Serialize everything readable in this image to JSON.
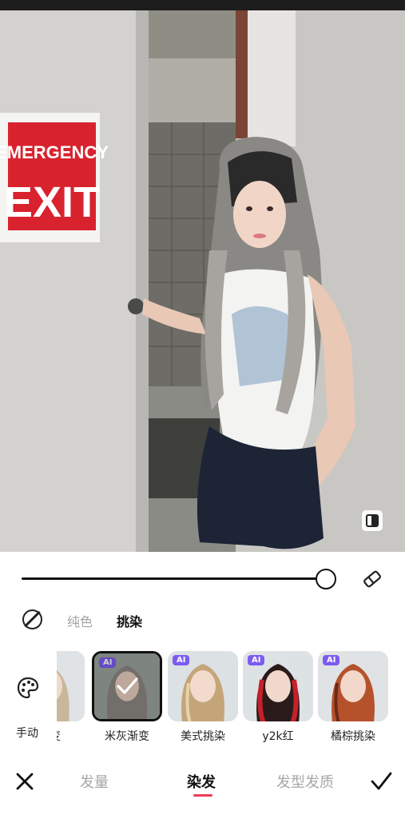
{
  "photo": {
    "sign_line1": "EMERGENCY",
    "sign_line2": "EXIT"
  },
  "subtabs": [
    {
      "label": "纯色",
      "active": false
    },
    {
      "label": "挑染",
      "active": true
    }
  ],
  "manual_label": "手动",
  "styles": [
    {
      "label": "渐变",
      "ai": false,
      "selected": false,
      "hair": "#c9b79b"
    },
    {
      "label": "米灰渐变",
      "ai": true,
      "selected": true,
      "hair": "#8c8780"
    },
    {
      "label": "美式挑染",
      "ai": true,
      "selected": false,
      "hair": "#c4a57a"
    },
    {
      "label": "y2k红",
      "ai": true,
      "selected": false,
      "hair": "#2a1a1a"
    },
    {
      "label": "橘棕挑染",
      "ai": true,
      "selected": false,
      "hair": "#b5522c"
    }
  ],
  "ai_badge": "AI",
  "bottom_tabs": [
    {
      "label": "发量",
      "active": false
    },
    {
      "label": "染发",
      "active": true
    },
    {
      "label": "发型发质",
      "active": false
    }
  ],
  "colors": {
    "accent": "#ef3b55",
    "ai_badge": "#7c5cf0"
  },
  "slider_value": 1.0
}
